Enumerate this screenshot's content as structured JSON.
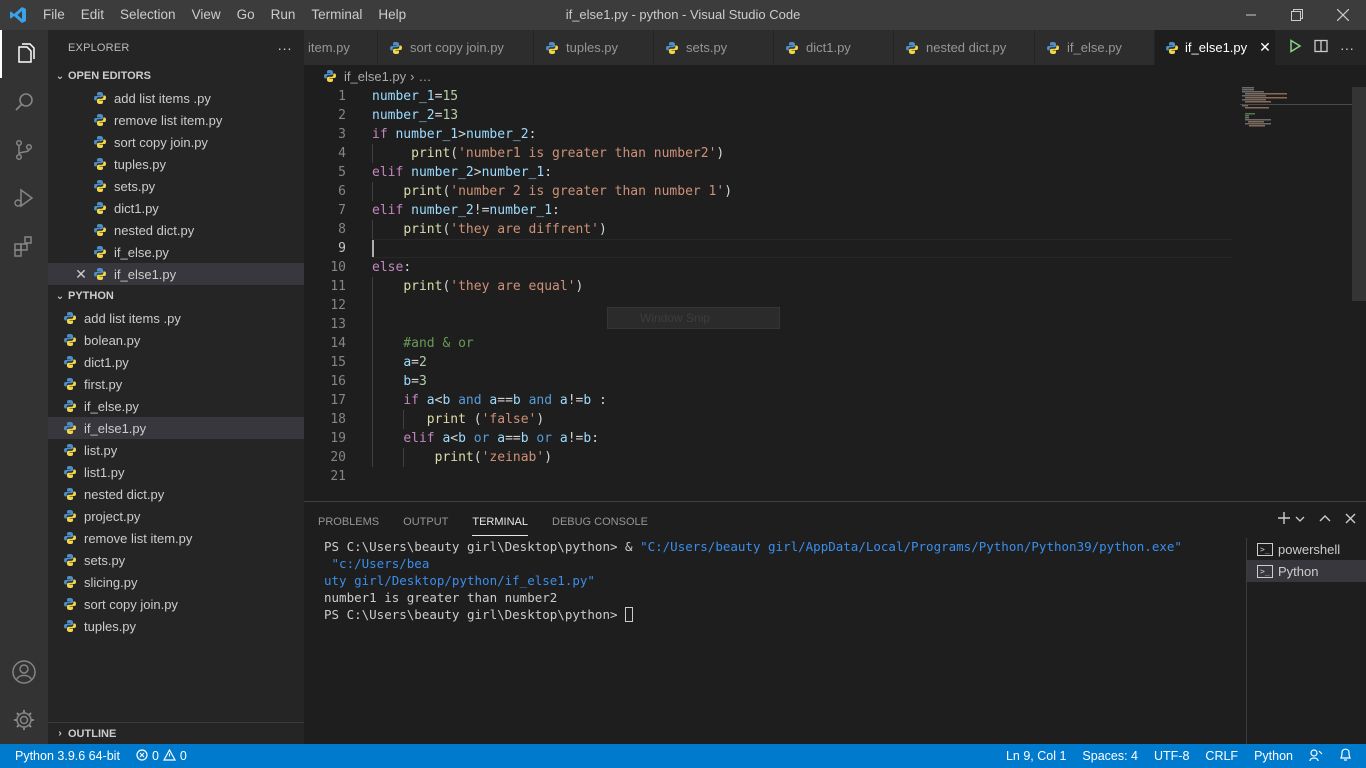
{
  "titlebar": {
    "menu": [
      "File",
      "Edit",
      "Selection",
      "View",
      "Go",
      "Run",
      "Terminal",
      "Help"
    ],
    "title": "if_else1.py - python - Visual Studio Code"
  },
  "sidebar": {
    "header": "EXPLORER",
    "more": "···",
    "open_editors": {
      "title": "OPEN EDITORS",
      "files": [
        "add list items .py",
        "remove list item.py",
        "sort copy join.py",
        "tuples.py",
        "sets.py",
        "dict1.py",
        "nested dict.py",
        "if_else.py",
        "if_else1.py"
      ]
    },
    "python": {
      "title": "PYTHON",
      "files": [
        "add list items .py",
        "bolean.py",
        "dict1.py",
        "first.py",
        "if_else.py",
        "if_else1.py",
        "list.py",
        "list1.py",
        "nested dict.py",
        "project.py",
        "remove list item.py",
        "sets.py",
        "slicing.py",
        "sort copy join.py",
        "tuples.py"
      ]
    },
    "outline": "OUTLINE"
  },
  "tabs": [
    "item.py",
    "sort copy join.py",
    "tuples.py",
    "sets.py",
    "dict1.py",
    "nested dict.py",
    "if_else.py",
    "if_else1.py"
  ],
  "breadcrumb": {
    "file": "if_else1.py",
    "more": "…"
  },
  "editor": {
    "line_numbers": [
      "1",
      "2",
      "3",
      "4",
      "5",
      "6",
      "7",
      "8",
      "9",
      "10",
      "11",
      "12",
      "13",
      "14",
      "15",
      "16",
      "17",
      "18",
      "19",
      "20",
      "21"
    ],
    "lines": {
      "l1": "number_1=15",
      "l2": "number_2=13",
      "l3": "if number_1>number_2:",
      "l4": "     print('number1 is greater than number2')",
      "l5": "elif number_2>number_1:",
      "l6": "    print('number 2 is greater than number 1')",
      "l7": "elif number_2!=number_1:",
      "l8": "    print('they are diffrent')",
      "l9": "",
      "l10": "else:",
      "l11": "    print('they are equal')",
      "l12": "",
      "l13": "",
      "l14": "    #and & or",
      "l15": "    a=2",
      "l16": "    b=3",
      "l17": "    if a<b and a==b and a!=b :",
      "l18": "       print ('false')",
      "l19": "    elif a<b or a==b or a!=b:",
      "l20": "        print('zeinab')",
      "l21": ""
    },
    "overlay": "Window Snip"
  },
  "panel": {
    "tabs": [
      "PROBLEMS",
      "OUTPUT",
      "TERMINAL",
      "DEBUG CONSOLE"
    ],
    "terminal": {
      "prompt1": "PS C:\\Users\\beauty girl\\Desktop\\python> & ",
      "cmd_path1": "\"C:/Users/beauty girl/AppData/Local/Programs/Python/Python39/python.exe\"",
      "cmd_path2": " \"c:/Users/bea",
      "cmd_path3": "uty girl/Desktop/python/if_else1.py\"",
      "output": "number1 is greater than number2",
      "prompt2": "PS C:\\Users\\beauty girl\\Desktop\\python> "
    },
    "terminals": [
      "powershell",
      "Python"
    ]
  },
  "statusbar": {
    "python_version": "Python 3.9.6 64-bit",
    "errors": "0",
    "warnings": "0",
    "position": "Ln 9, Col 1",
    "spaces": "Spaces: 4",
    "encoding": "UTF-8",
    "eol": "CRLF",
    "language": "Python"
  },
  "colors": {
    "accent": "#007acc",
    "keyword": "#c586c0",
    "string": "#ce9178",
    "variable": "#9cdcfe"
  },
  "icons": [
    "vscode-logo-icon",
    "explorer-icon",
    "search-icon",
    "source-control-icon",
    "run-debug-icon",
    "extensions-icon",
    "account-icon",
    "settings-gear-icon",
    "python-file-icon",
    "run-file-icon",
    "split-editor-icon",
    "more-actions-icon"
  ]
}
